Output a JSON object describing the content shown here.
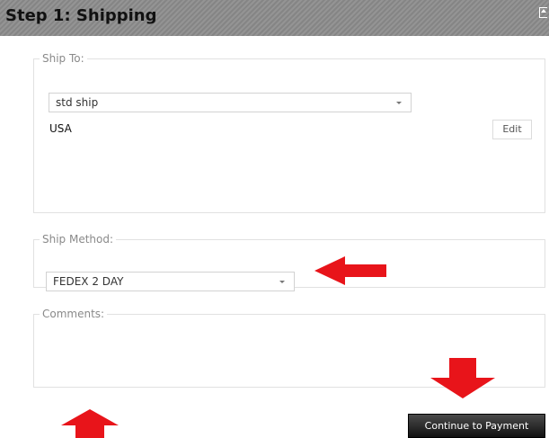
{
  "header": {
    "title": "Step 1: Shipping",
    "icon": "collapse-icon"
  },
  "ship_to": {
    "legend": "Ship To:",
    "address_select": {
      "value": "std ship",
      "icon": "chevron-down-icon"
    },
    "country": "USA",
    "edit_label": "Edit"
  },
  "ship_method": {
    "legend": "Ship Method:",
    "select": {
      "value": "FEDEX 2 DAY",
      "icon": "chevron-down-icon"
    }
  },
  "comments": {
    "legend": "Comments:",
    "value": ""
  },
  "footer": {
    "continue_label": "Continue to Payment"
  },
  "annotations": {
    "arrow_color": "#e8141a",
    "arrows": [
      "left-arrow-icon",
      "down-arrow-icon",
      "up-arrow-icon"
    ]
  },
  "colors": {
    "header_bg": "#8c8c8c",
    "button_bg": "#1f1f1f",
    "border": "#e1e1e1"
  }
}
